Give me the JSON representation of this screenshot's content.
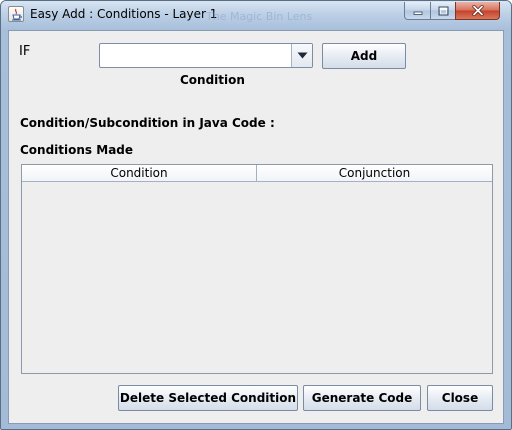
{
  "window": {
    "title": "Easy Add : Conditions - Layer 1",
    "title_ghost": "The Magic Bin Lens",
    "title_icon": "java-cup-icon",
    "controls": {
      "minimize_icon": "minimize-icon",
      "maximize_icon": "maximize-icon",
      "close_icon": "close-icon"
    }
  },
  "form": {
    "if_label": "IF",
    "condition_combo": {
      "selected": "",
      "dropdown_icon": "triangle-down-icon"
    },
    "condition_caption": "Condition",
    "add_button": "Add",
    "java_code_label": "Condition/Subcondition in Java Code :",
    "conditions_made_label": "Conditions Made"
  },
  "table": {
    "columns": [
      "Condition",
      "Conjunction"
    ],
    "rows": []
  },
  "footer": {
    "delete_button": "Delete Selected Condition",
    "generate_button": "Generate Code",
    "close_button": "Close"
  },
  "colors": {
    "panel_background": "#eeeeee",
    "titlebar_gradient_top": "#d8e5f3",
    "close_button_red": "#c4402a"
  }
}
